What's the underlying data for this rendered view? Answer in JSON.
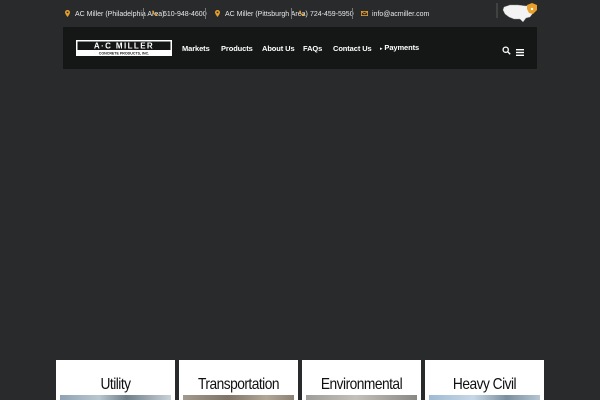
{
  "topbar": {
    "philly_label": "AC Miller (Philadelphia Area)",
    "philly_phone": "610-948-4600",
    "pitt_label": "AC Miller (Pittsburgh Area)",
    "pitt_phone": "724-459-5950",
    "email": "info@acmiller.com"
  },
  "logo": {
    "wordmark": "A·C MILLER",
    "subtitle": "CONCRETE PRODUCTS, INC."
  },
  "nav": {
    "items": [
      "Markets",
      "Products",
      "About Us",
      "FAQs",
      "Contact Us"
    ],
    "payments": "Payments"
  },
  "cards": [
    {
      "title": "Utility"
    },
    {
      "title": "Transportation"
    },
    {
      "title": "Environmental"
    },
    {
      "title": "Heavy Civil"
    }
  ],
  "colors": {
    "page_bg": "#282a2c",
    "nav_bg": "#151616",
    "accent": "#e8a02a",
    "card_bg": "#ffffff"
  }
}
